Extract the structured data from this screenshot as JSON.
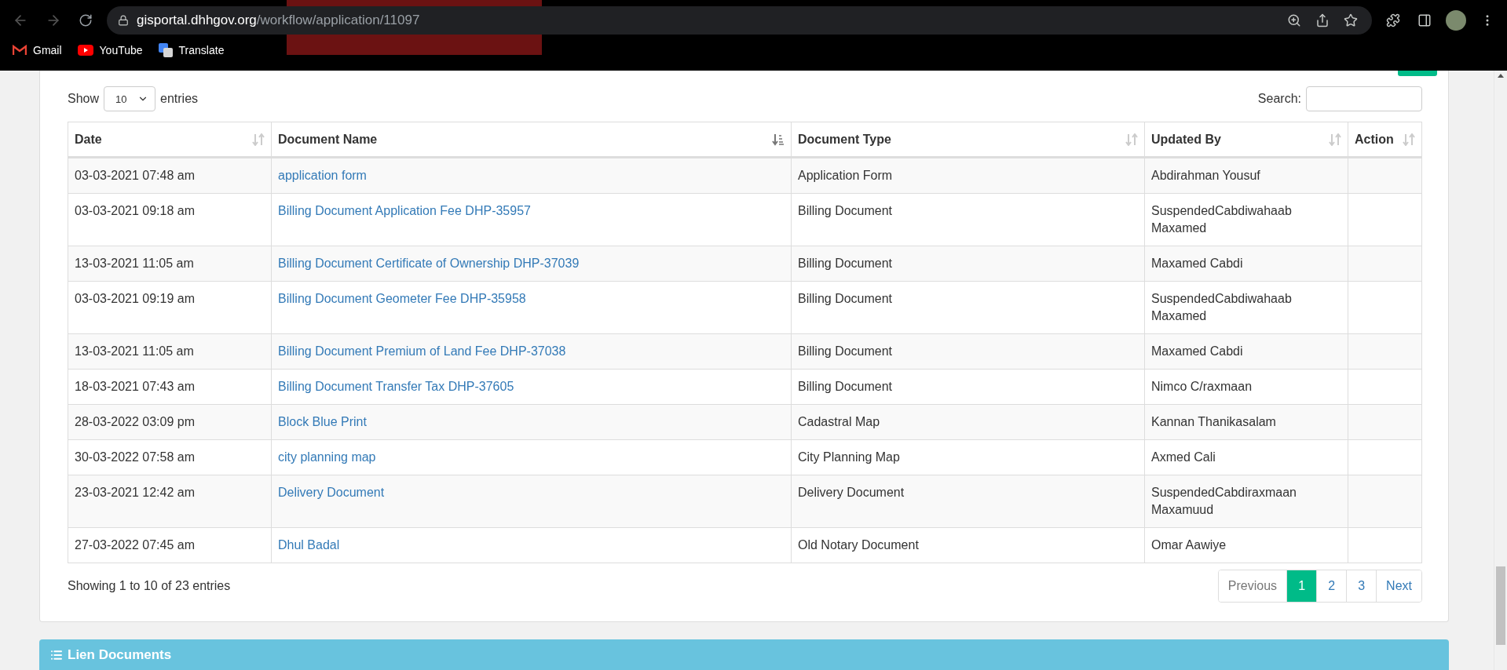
{
  "browser": {
    "url_host": "gisportal.dhhgov.org",
    "url_path": "/workflow/application/11097",
    "bookmarks": [
      {
        "kind": "gmail",
        "label": "Gmail"
      },
      {
        "kind": "youtube",
        "label": "YouTube"
      },
      {
        "kind": "translate",
        "label": "Translate"
      }
    ]
  },
  "length_menu": {
    "label_before": "Show",
    "value": "10",
    "label_after": "entries"
  },
  "search": {
    "label": "Search:"
  },
  "table": {
    "columns": [
      {
        "label": "Date",
        "sorted": false
      },
      {
        "label": "Document Name",
        "sorted": true
      },
      {
        "label": "Document Type",
        "sorted": false
      },
      {
        "label": "Updated By",
        "sorted": false
      },
      {
        "label": "Action",
        "sorted": false
      }
    ],
    "rows": [
      {
        "date": "03-03-2021 07:48 am",
        "document_name": "application form",
        "document_type": "Application Form",
        "updated_by": "Abdirahman Yousuf"
      },
      {
        "date": "03-03-2021 09:18 am",
        "document_name": "Billing Document Application Fee DHP-35957",
        "document_type": "Billing Document",
        "updated_by": "SuspendedCabdiwahaab Maxamed"
      },
      {
        "date": "13-03-2021 11:05 am",
        "document_name": "Billing Document Certificate of Ownership DHP-37039",
        "document_type": "Billing Document",
        "updated_by": "Maxamed Cabdi"
      },
      {
        "date": "03-03-2021 09:19 am",
        "document_name": "Billing Document Geometer Fee DHP-35958",
        "document_type": "Billing Document",
        "updated_by": "SuspendedCabdiwahaab Maxamed"
      },
      {
        "date": "13-03-2021 11:05 am",
        "document_name": "Billing Document Premium of Land Fee DHP-37038",
        "document_type": "Billing Document",
        "updated_by": "Maxamed Cabdi"
      },
      {
        "date": "18-03-2021 07:43 am",
        "document_name": "Billing Document Transfer Tax DHP-37605",
        "document_type": "Billing Document",
        "updated_by": "Nimco C/raxmaan"
      },
      {
        "date": "28-03-2022 03:09 pm",
        "document_name": "Block Blue Print",
        "document_type": "Cadastral Map",
        "updated_by": "Kannan Thanikasalam"
      },
      {
        "date": "30-03-2022 07:58 am",
        "document_name": "city planning map",
        "document_type": "City Planning Map",
        "updated_by": "Axmed Cali"
      },
      {
        "date": "23-03-2021 12:42 am",
        "document_name": "Delivery Document",
        "document_type": "Delivery Document",
        "updated_by": "SuspendedCabdiraxmaan Maxamuud"
      },
      {
        "date": "27-03-2022 07:45 am",
        "document_name": "Dhul Badal",
        "document_type": "Old Notary Document",
        "updated_by": "Omar Aawiye"
      }
    ]
  },
  "info": "Showing 1 to 10 of 23 entries",
  "pagination": {
    "previous": {
      "label": "Previous",
      "disabled": true
    },
    "pages": [
      {
        "label": "1",
        "selected": true
      },
      {
        "label": "2",
        "selected": false
      },
      {
        "label": "3",
        "selected": false
      }
    ],
    "next": {
      "label": "Next",
      "disabled": false
    }
  },
  "next_section": {
    "title": "Lien Documents"
  }
}
